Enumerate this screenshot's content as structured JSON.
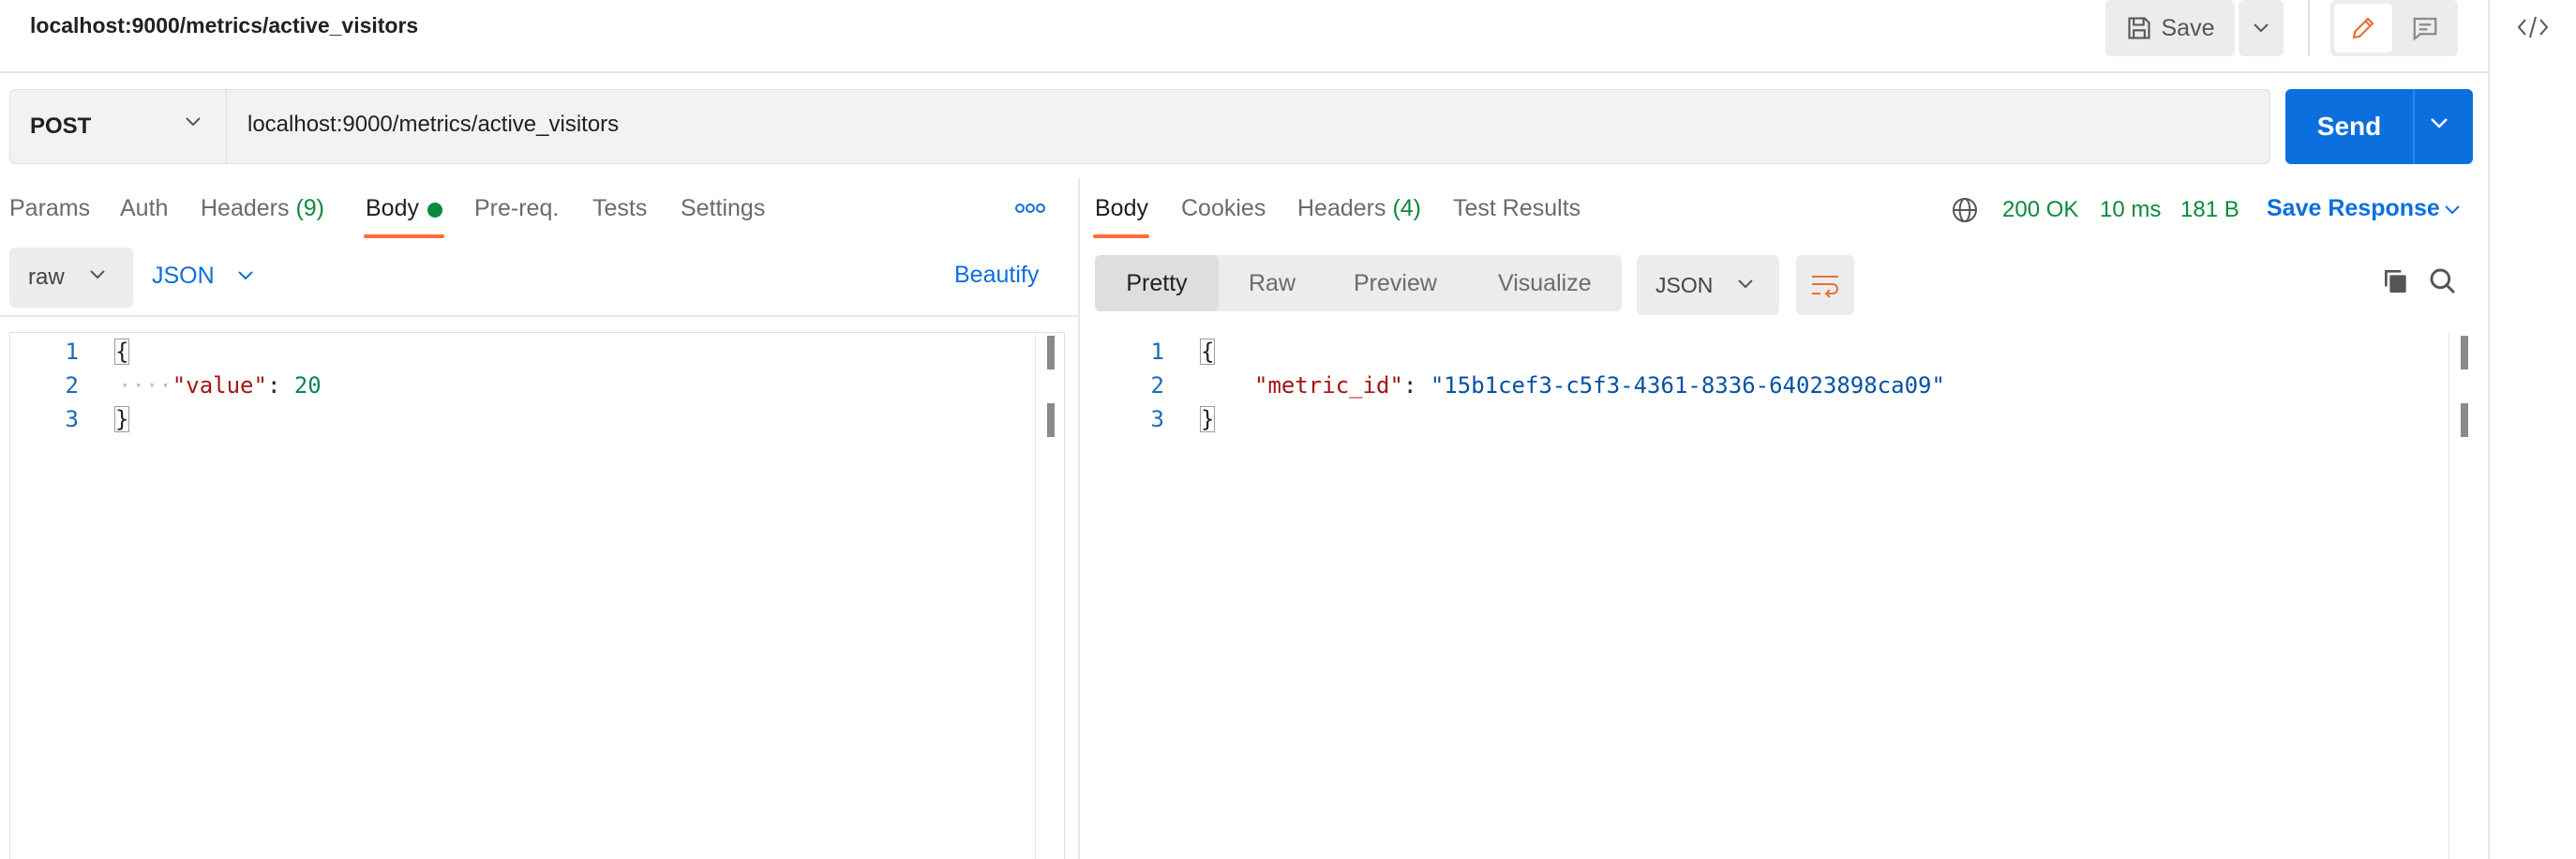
{
  "header": {
    "title": "localhost:9000/metrics/active_visitors",
    "save_label": "Save"
  },
  "request": {
    "method": "POST",
    "url": "localhost:9000/metrics/active_visitors",
    "send_label": "Send",
    "tabs": {
      "params": "Params",
      "auth": "Auth",
      "headers": "Headers",
      "headers_count": "(9)",
      "body": "Body",
      "prereq": "Pre-req.",
      "tests": "Tests",
      "settings": "Settings"
    },
    "body_mode": "raw",
    "body_language": "JSON",
    "beautify_label": "Beautify",
    "line_numbers": [
      "1",
      "2",
      "3"
    ],
    "code": {
      "open": "{",
      "key": "\"value\"",
      "colon": ": ",
      "value": "20",
      "close": "}"
    }
  },
  "response": {
    "tabs": {
      "body": "Body",
      "cookies": "Cookies",
      "headers": "Headers",
      "headers_count": "(4)",
      "test_results": "Test Results"
    },
    "status": "200 OK",
    "time": "10 ms",
    "size": "181 B",
    "save_response_label": "Save Response",
    "views": [
      "Pretty",
      "Raw",
      "Preview",
      "Visualize"
    ],
    "format": "JSON",
    "line_numbers": [
      "1",
      "2",
      "3"
    ],
    "code": {
      "open": "{",
      "key": "\"metric_id\"",
      "colon": ": ",
      "value": "\"15b1cef3-c5f3-4361-8336-64023898ca09\"",
      "close": "}"
    }
  },
  "colors": {
    "accent": "#ff6c37",
    "primary": "#0b6fde",
    "success": "#0a8a3a"
  }
}
